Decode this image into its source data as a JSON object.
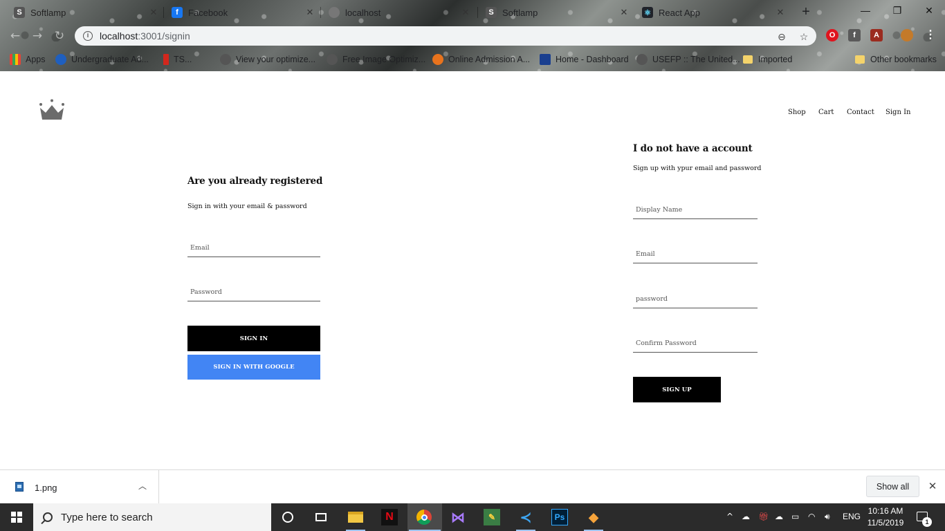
{
  "browser": {
    "tabs": [
      {
        "label": "Softlamp",
        "favicon": "S",
        "color": "#444444"
      },
      {
        "label": "Facebook",
        "favicon": "f",
        "color": "#1877f2"
      },
      {
        "label": "localhost",
        "favicon": "globe",
        "color": "#666666"
      },
      {
        "label": "Softlamp",
        "favicon": "S",
        "color": "#444444"
      },
      {
        "label": "React App",
        "favicon": "react",
        "color": "#20232a"
      }
    ],
    "url_host": "localhost",
    "url_path": ":3001/signin",
    "bookmarks": [
      {
        "label": "Apps"
      },
      {
        "label": "Undergraduate Ad..."
      },
      {
        "label": "TS..."
      },
      {
        "label": "View your optimize..."
      },
      {
        "label": "Free Image Optimiz..."
      },
      {
        "label": "Online Admission A..."
      },
      {
        "label": "Home - Dashboard"
      },
      {
        "label": "USEFP :: The United..."
      },
      {
        "label": "Imported"
      },
      {
        "label": "Other bookmarks"
      }
    ]
  },
  "site": {
    "nav": {
      "shop": "Shop",
      "cart": "Cart",
      "contact": "Contact",
      "signin": "Sign In"
    },
    "signin": {
      "title": "Are you already registered",
      "subtitle": "Sign in with your email & password",
      "email_placeholder": "Email",
      "password_placeholder": "Password",
      "submit_label": "Sign in",
      "google_label": "Sign in with Google"
    },
    "signup": {
      "title": "I do not have a account",
      "subtitle": "Sign up with ypur email and password",
      "display_name_placeholder": "Display Name",
      "email_placeholder": "Email",
      "password_placeholder": "password",
      "confirm_placeholder": "Confirm Password",
      "submit_label": "Sign Up"
    },
    "colors": {
      "primary_button": "#000000",
      "google_button": "#4285f4"
    }
  },
  "downloads": {
    "file_name": "1.png",
    "show_all": "Show all"
  },
  "taskbar": {
    "search_placeholder": "Type here to search",
    "language": "ENG",
    "time": "10:16 AM",
    "date": "11/5/2019",
    "notification_count": "1"
  }
}
